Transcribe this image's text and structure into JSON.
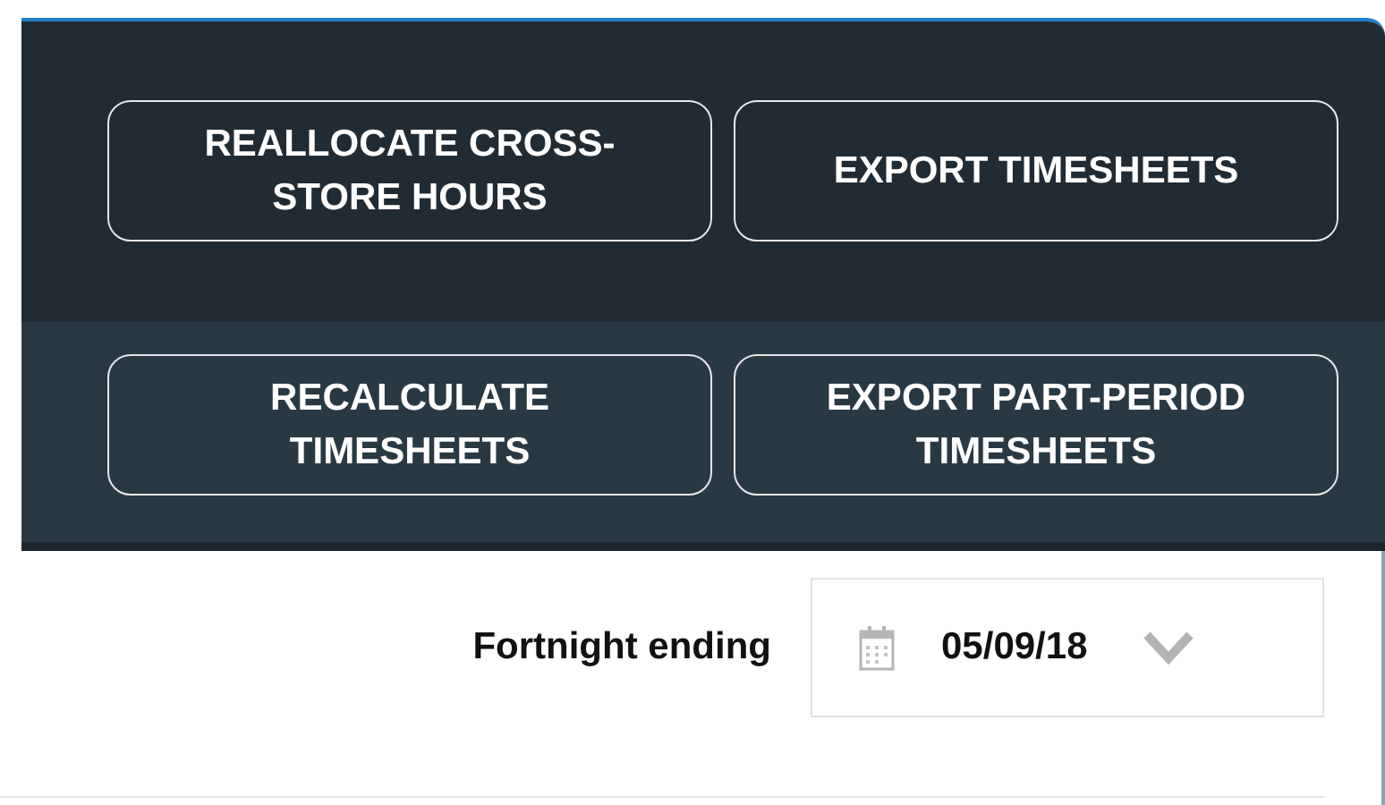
{
  "action_rows": [
    {
      "buttons": [
        {
          "label": "REALLOCATE CROSS-\nSTORE HOURS"
        },
        {
          "label": "EXPORT TIMESHEETS"
        }
      ]
    },
    {
      "buttons": [
        {
          "label": "RECALCULATE\nTIMESHEETS"
        },
        {
          "label": "EXPORT PART-PERIOD\nTIMESHEETS"
        }
      ]
    }
  ],
  "period_filter": {
    "label": "Fortnight ending",
    "value": "05/09/18"
  }
}
